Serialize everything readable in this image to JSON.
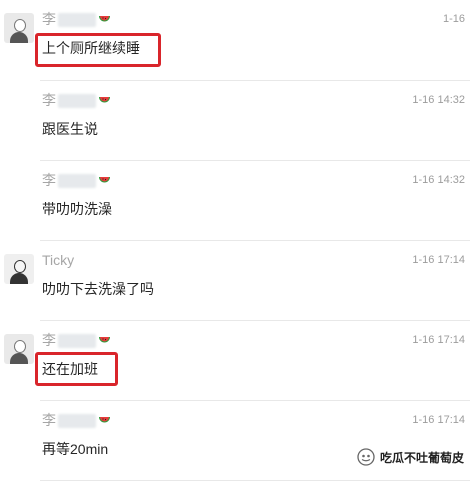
{
  "messages": [
    {
      "sender": "李",
      "text": "上个厕所继续睡",
      "time": "1-16",
      "avatar": "person-avatar",
      "highlighted": true
    },
    {
      "sender": "李",
      "text": "跟医生说",
      "time": "1-16 14:32",
      "avatar": "",
      "highlighted": false
    },
    {
      "sender": "李",
      "text": "带叻叻洗澡",
      "time": "1-16 14:32",
      "avatar": "",
      "highlighted": false
    },
    {
      "sender": "Ticky",
      "text": "叻叻下去洗澡了吗",
      "time": "1-16 17:14",
      "avatar": "ticky-avatar",
      "highlighted": false
    },
    {
      "sender": "李",
      "text": "还在加班",
      "time": "1-16 17:14",
      "avatar": "person-avatar",
      "highlighted": true
    },
    {
      "sender": "李",
      "text": "再等20min",
      "time": "1-16 17:14",
      "avatar": "",
      "highlighted": false
    }
  ],
  "watermark": {
    "label": "吃瓜不吐葡萄皮"
  },
  "colors": {
    "highlight": "#d9252b",
    "sender": "#a6a6a6",
    "time": "#9c9c9c",
    "text": "#262626"
  }
}
